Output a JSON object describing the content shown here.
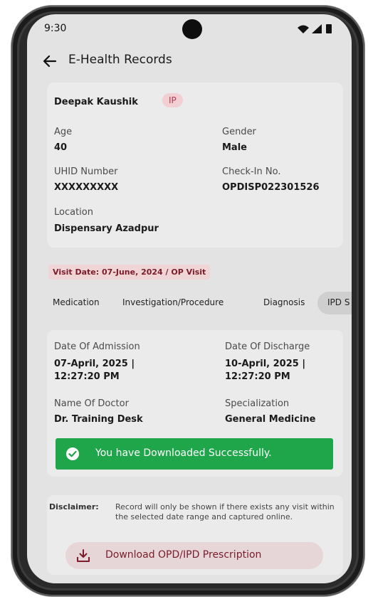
{
  "status_bar": {
    "time": "9:30"
  },
  "appbar": {
    "title": "E-Health Records"
  },
  "patient": {
    "name": "Deepak Kaushik",
    "badge": "IP",
    "age_label": "Age",
    "age": "40",
    "gender_label": "Gender",
    "gender": "Male",
    "uhid_label": "UHID Number",
    "uhid": "XXXXXXXXX",
    "checkin_label": "Check-In No.",
    "checkin": "OPDISP022301526",
    "location_label": "Location",
    "location": "Dispensary Azadpur"
  },
  "visit": {
    "label": "Visit Date: 07-June, 2024 / OP Visit"
  },
  "tabs": [
    {
      "label": "Medication"
    },
    {
      "label": "Investigation/Procedure"
    },
    {
      "label": "Diagnosis"
    },
    {
      "label": "IPD S"
    }
  ],
  "admission": {
    "admission_label": "Date Of Admission",
    "admission_line1": "07-April, 2025 |",
    "admission_line2": "12:27:20 PM",
    "discharge_label": "Date Of Discharge",
    "discharge_line1": "10-April, 2025 |",
    "discharge_line2": "12:27:20 PM",
    "doctor_label": "Name Of Doctor",
    "doctor": "Dr. Training Desk",
    "specialization_label": "Specialization",
    "specialization": "General Medicine"
  },
  "toast": {
    "message": "You have Downloaded Successfully.",
    "color": "#1fa64a"
  },
  "disclaimer": {
    "label": "Disclaimer:",
    "text": "Record will only be shown if there exists any visit within the selected date range and captured online."
  },
  "download": {
    "label": "Download OPD/IPD Prescription",
    "icon": "download-icon"
  },
  "colors": {
    "accent": "#7a1c2a",
    "badge_bg": "#f2cfd3",
    "screen_bg": "#e3e3e3"
  }
}
